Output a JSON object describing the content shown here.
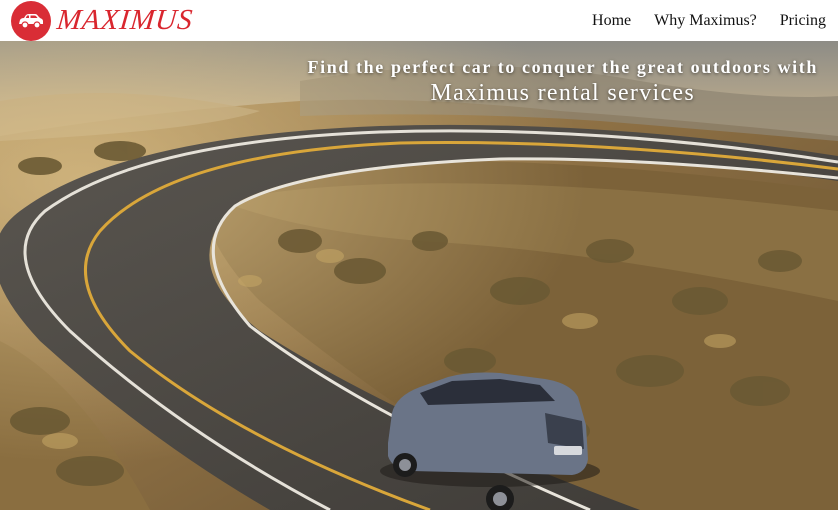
{
  "brand": {
    "name": "MAXIMUS",
    "logo_icon": "car-icon",
    "color": "#d9262e"
  },
  "nav": {
    "items": [
      {
        "label": "Home"
      },
      {
        "label": "Why Maximus?"
      },
      {
        "label": "Pricing"
      }
    ]
  },
  "hero": {
    "headline_line1": "Find the perfect car to conquer the great outdoors with",
    "headline_line2": "Maximus rental services",
    "image": "photo of a silver SUV driving on a curving desert road"
  }
}
